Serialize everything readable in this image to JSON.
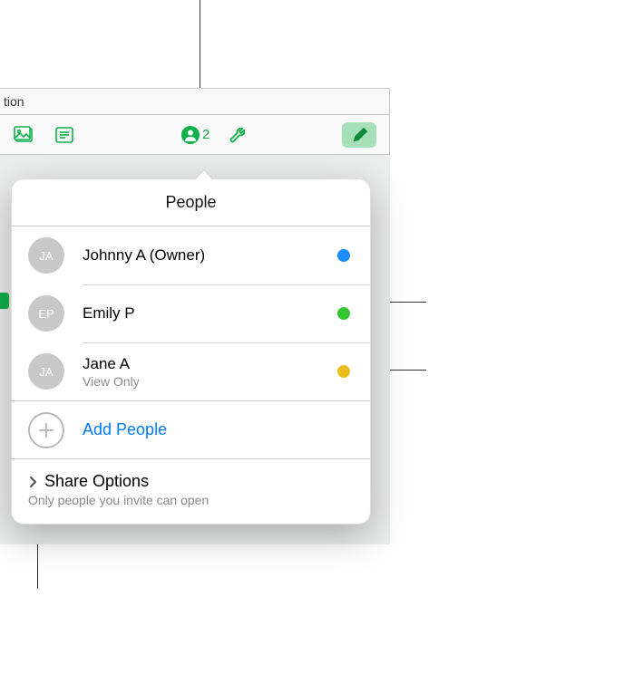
{
  "toolbar": {
    "doc_title_fragment": "tion",
    "collab_count": "2"
  },
  "popover": {
    "title": "People",
    "people": [
      {
        "initials": "JA",
        "name": "Johnny A",
        "role": "(Owner)",
        "sub": "",
        "dot": "#1d8cff"
      },
      {
        "initials": "EP",
        "name": "Emily P",
        "role": "",
        "sub": "",
        "dot": "#34c632"
      },
      {
        "initials": "JA",
        "name": "Jane A",
        "role": "",
        "sub": "View Only",
        "dot": "#e9bf1f"
      }
    ],
    "add_label": "Add People",
    "share_title": "Share Options",
    "share_sub": "Only people you invite can open"
  }
}
